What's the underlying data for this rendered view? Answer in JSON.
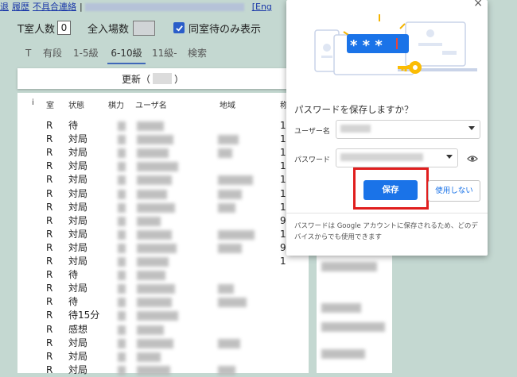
{
  "top_links": {
    "link1": "退",
    "link2": "履歴",
    "link3": "不具合連絡",
    "separator": "|",
    "link4": "[Eng"
  },
  "filters": {
    "t_room_label": "T室人数",
    "t_room_value": "0",
    "total_label": "全入場数",
    "waiting_only_label": "同室待のみ表示"
  },
  "tabs": [
    "T",
    "有段",
    "1-5級",
    "6-10級",
    "11級-",
    "検索"
  ],
  "update_bar": {
    "label_open": "更新（",
    "label_close": "）"
  },
  "table": {
    "headers": [
      "i",
      "室",
      "状態",
      "棋力",
      "ユーザ名",
      "地域",
      "称"
    ],
    "rows": [
      {
        "room": "R",
        "status": "待"
      },
      {
        "room": "R",
        "status": "対局"
      },
      {
        "room": "R",
        "status": "対局"
      },
      {
        "room": "R",
        "status": "対局"
      },
      {
        "room": "R",
        "status": "対局"
      },
      {
        "room": "R",
        "status": "対局"
      },
      {
        "room": "R",
        "status": "対局"
      },
      {
        "room": "R",
        "status": "対局"
      },
      {
        "room": "R",
        "status": "対局"
      },
      {
        "room": "R",
        "status": "対局"
      },
      {
        "room": "R",
        "status": "対局"
      },
      {
        "room": "R",
        "status": "待"
      },
      {
        "room": "R",
        "status": "対局"
      },
      {
        "room": "R",
        "status": "待"
      },
      {
        "room": "R",
        "status": "待15分"
      },
      {
        "room": "R",
        "status": "感想"
      },
      {
        "room": "R",
        "status": "対局"
      },
      {
        "room": "R",
        "status": "対局"
      },
      {
        "room": "R",
        "status": "対局"
      }
    ],
    "side_numbers": [
      "1",
      "1",
      "1",
      "1",
      "1",
      "1",
      "1",
      "9",
      "1",
      "9",
      "1"
    ]
  },
  "popup": {
    "close_icon": "×",
    "masked_password": "* * *",
    "title": "パスワードを保存しますか？",
    "username_label": "ユーザー名",
    "password_label": "パスワード",
    "save_label": "保存",
    "never_label": "使用しない",
    "footnote": "パスワードは Google アカウントに保存されるため、どのデバイスからでも使用できます",
    "accent_color": "#1a73e8",
    "highlight_color": "#e01e1e"
  }
}
